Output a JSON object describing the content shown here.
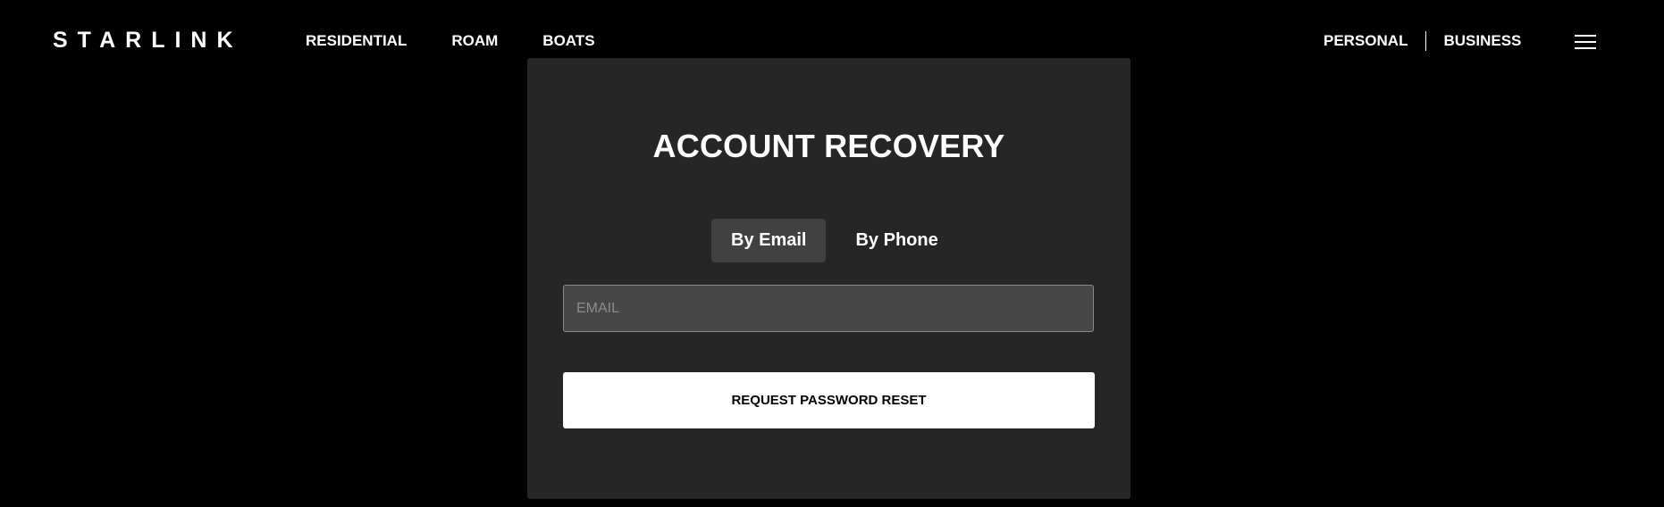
{
  "header": {
    "logo": "STARLINK",
    "nav_left": [
      "RESIDENTIAL",
      "ROAM",
      "BOATS"
    ],
    "nav_right": [
      "PERSONAL",
      "BUSINESS"
    ],
    "menu_icon": "hamburger-menu-icon"
  },
  "card": {
    "title": "ACCOUNT RECOVERY",
    "tabs": [
      {
        "label": "By Email",
        "active": true
      },
      {
        "label": "By Phone",
        "active": false
      }
    ],
    "email_placeholder": "EMAIL",
    "email_value": "",
    "submit_label": "REQUEST PASSWORD RESET"
  },
  "colors": {
    "page_background": "#000000",
    "card_background": "#262626",
    "active_tab_background": "#414141",
    "input_background": "#474747",
    "button_background": "#ffffff"
  }
}
